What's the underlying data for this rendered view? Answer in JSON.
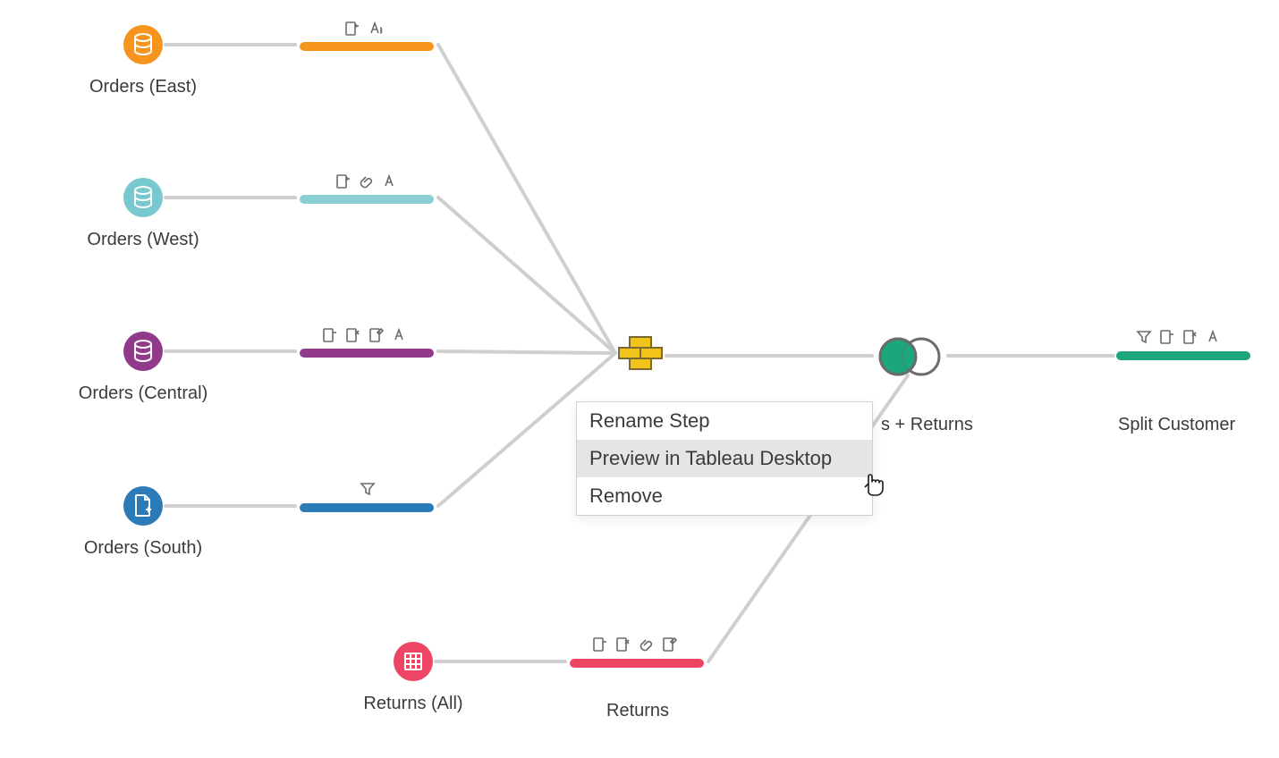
{
  "nodes": {
    "orders_east": {
      "label": "Orders (East)",
      "color": "#f7941d"
    },
    "orders_west": {
      "label": "Orders (West)",
      "color": "#77c9cf"
    },
    "orders_central": {
      "label": "Orders (Central)",
      "color": "#913a8c"
    },
    "orders_south": {
      "label": "Orders (South)",
      "color": "#2b7bb9"
    },
    "returns_all": {
      "label": "Returns (All)",
      "color": "#ec4664"
    },
    "returns": {
      "label": "Returns",
      "color": "#ec4664"
    },
    "orders_returns": {
      "label": "s + Returns"
    },
    "split_customer": {
      "label": "Split Customer",
      "color": "#1ba67e"
    }
  },
  "context_menu": {
    "rename": "Rename Step",
    "preview": "Preview in Tableau Desktop",
    "remove": "Remove"
  }
}
